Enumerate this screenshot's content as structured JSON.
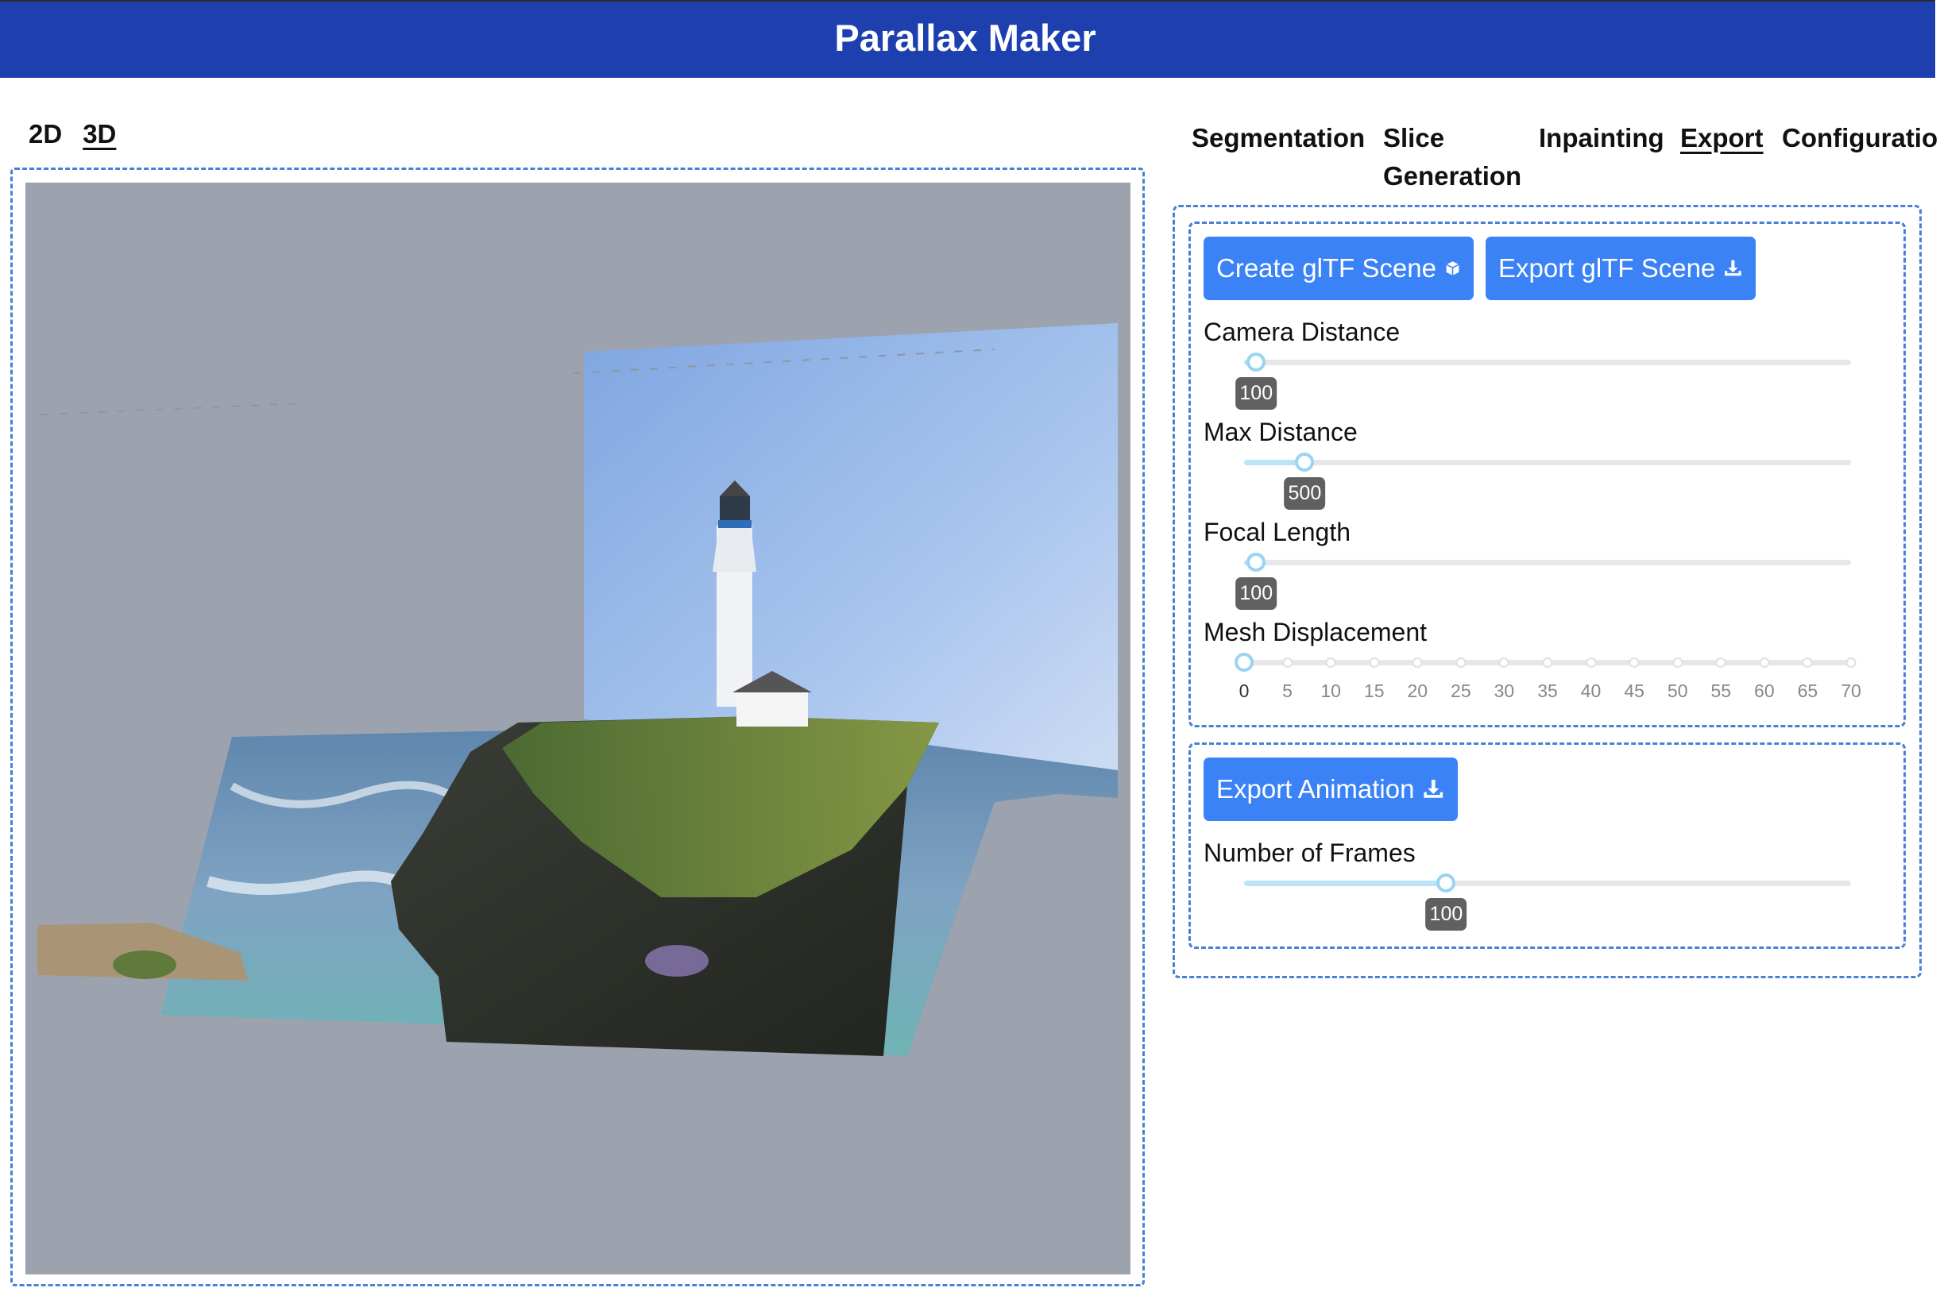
{
  "app": {
    "title": "Parallax Maker"
  },
  "view_tabs": [
    {
      "label": "2D",
      "active": false
    },
    {
      "label": "3D",
      "active": true
    }
  ],
  "nav_tabs": [
    {
      "label": "Segmentation",
      "active": false
    },
    {
      "label": "Slice\nGeneration",
      "active": false
    },
    {
      "label": "Inpainting",
      "active": false
    },
    {
      "label": "Export",
      "active": true
    },
    {
      "label": "Configuratio",
      "active": false
    }
  ],
  "gltf": {
    "create_label": "Create glTF Scene",
    "export_label": "Export glTF Scene",
    "sliders": [
      {
        "label": "Camera Distance",
        "value": "100",
        "fraction": 0.02
      },
      {
        "label": "Max Distance",
        "value": "500",
        "fraction": 0.1
      },
      {
        "label": "Focal Length",
        "value": "100",
        "fraction": 0.02
      }
    ],
    "mesh": {
      "label": "Mesh Displacement",
      "value": 0,
      "ticks": [
        "0",
        "5",
        "10",
        "15",
        "20",
        "25",
        "30",
        "35",
        "40",
        "45",
        "50",
        "55",
        "60",
        "65",
        "70"
      ]
    }
  },
  "animation": {
    "export_label": "Export Animation",
    "frames_label": "Number of Frames",
    "frames_value": "100",
    "frames_fraction": 0.333
  },
  "colors": {
    "header": "#1e40af",
    "button": "#3b82f6",
    "dashed_border": "#4a7fd6",
    "viewer_bg": "#9ca3ae"
  },
  "icons": {
    "create": "cube-icon",
    "export": "download-icon",
    "animation": "download-icon"
  }
}
